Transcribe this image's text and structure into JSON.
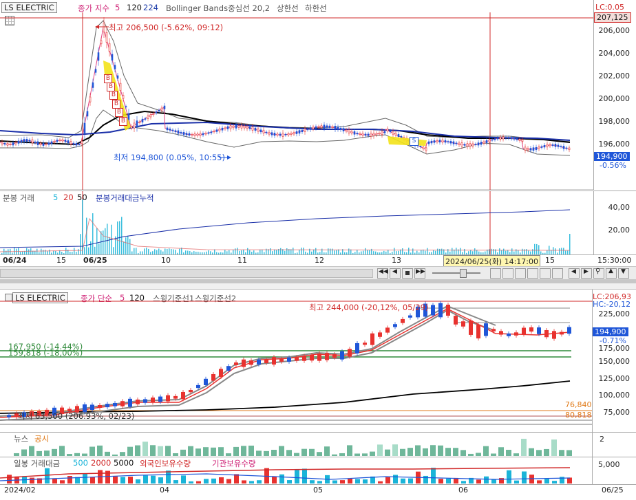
{
  "top": {
    "name": "LS ELECTRIC",
    "ind_label": "종가 지수",
    "ma1": "5",
    "ma2": "120",
    "ma3": "224",
    "bb": "Bollinger Bands중심선 20,2",
    "bb_up": "상한선",
    "bb_dn": "하한선",
    "lc": "LC:0.05",
    "price_top": "207,125",
    "yticks": [
      "206,000",
      "204,000",
      "202,000",
      "200,000",
      "198,000",
      "196,000"
    ],
    "cur_price": "194,900",
    "cur_change": "-0.56%",
    "high_label": "최고 206,500 (-5.62%, 09:12)",
    "low_label": "최저 194,800 (0.05%, 10:55)",
    "vol_label": "분봉 거래",
    "vol_ma1": "5",
    "vol_ma2": "20",
    "vol_ma3": "50",
    "vol_cum": "분봉거래대금누적",
    "vol_yticks": [
      "40,00",
      "20,00"
    ],
    "x_labels": [
      "06/24",
      "15",
      "06/25",
      "10",
      "11",
      "12",
      "13",
      "15"
    ],
    "x_right": "15:30:00",
    "cursor_label": "2024/06/25(화) 14:17:00",
    "marker_b": "B",
    "marker_s": "S"
  },
  "bottom": {
    "name": "LS ELECTRIC",
    "ind_label": "종가 단순",
    "ma1": "5",
    "ma2": "120",
    "swing1": "스윙기준선1",
    "swing2": "스윙기준선2",
    "lc": "LC:206,93",
    "hc": "HC:-20,12",
    "yticks": [
      "225,000",
      "175,000",
      "150,000",
      "125,000",
      "100,000",
      "75,000"
    ],
    "cur_price": "194,900",
    "cur_change": "-0.71%",
    "high_label": "최고 244,000 (-20,12%, 05/29)",
    "low_label": "최저 63,500 (206.93%, 02/23)",
    "line1": "167,950 (-14.44%)",
    "line2": "159,818 (-18,00%)",
    "r1": "76,840",
    "r2": "80,818",
    "news": "뉴스",
    "notice": "공시",
    "news_ytick": "2",
    "vol_label": "일봉 거래대금",
    "vol_ma1": "500",
    "vol_ma2": "2000",
    "vol_ma3": "5000",
    "foreign": "외국인보유수량",
    "inst": "기관보유수량",
    "vol_ytick": "5,000",
    "x_labels": [
      "2024/02",
      "04",
      "05",
      "06",
      "06/25"
    ]
  },
  "colors": {
    "up": "#e8322f",
    "down": "#1f56d8",
    "ma_blue": "#2233aa",
    "black": "#000000",
    "green": "#2f8a3a",
    "orange": "#e07a18"
  }
}
